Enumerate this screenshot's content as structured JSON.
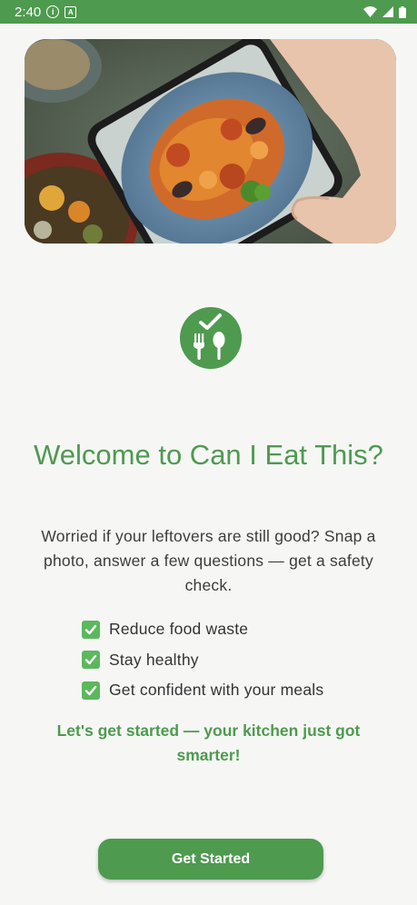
{
  "status_bar": {
    "time": "2:40",
    "notification_icons": [
      "info-icon",
      "app-notification-icon"
    ],
    "system_icons": [
      "wifi-icon",
      "signal-icon",
      "battery-icon"
    ]
  },
  "hero": {
    "image_subject": "hand photographing a seafood pasta plate with a phone"
  },
  "welcome": {
    "title": "Welcome to Can I Eat This?",
    "description": "Worried if your leftovers are still good? Snap a photo, answer a few questions — get a safety check.",
    "benefits": [
      {
        "icon": "check-mark-icon",
        "label": "Reduce food waste"
      },
      {
        "icon": "check-mark-icon",
        "label": "Stay healthy"
      },
      {
        "icon": "check-mark-icon",
        "label": "Get confident with your meals"
      }
    ],
    "tagline": "Let's get started — your kitchen just got smarter!",
    "cta_label": "Get Started"
  },
  "colors": {
    "brand": "#4e9a4f",
    "check": "#5cb85c",
    "background": "#f6f7f5"
  }
}
